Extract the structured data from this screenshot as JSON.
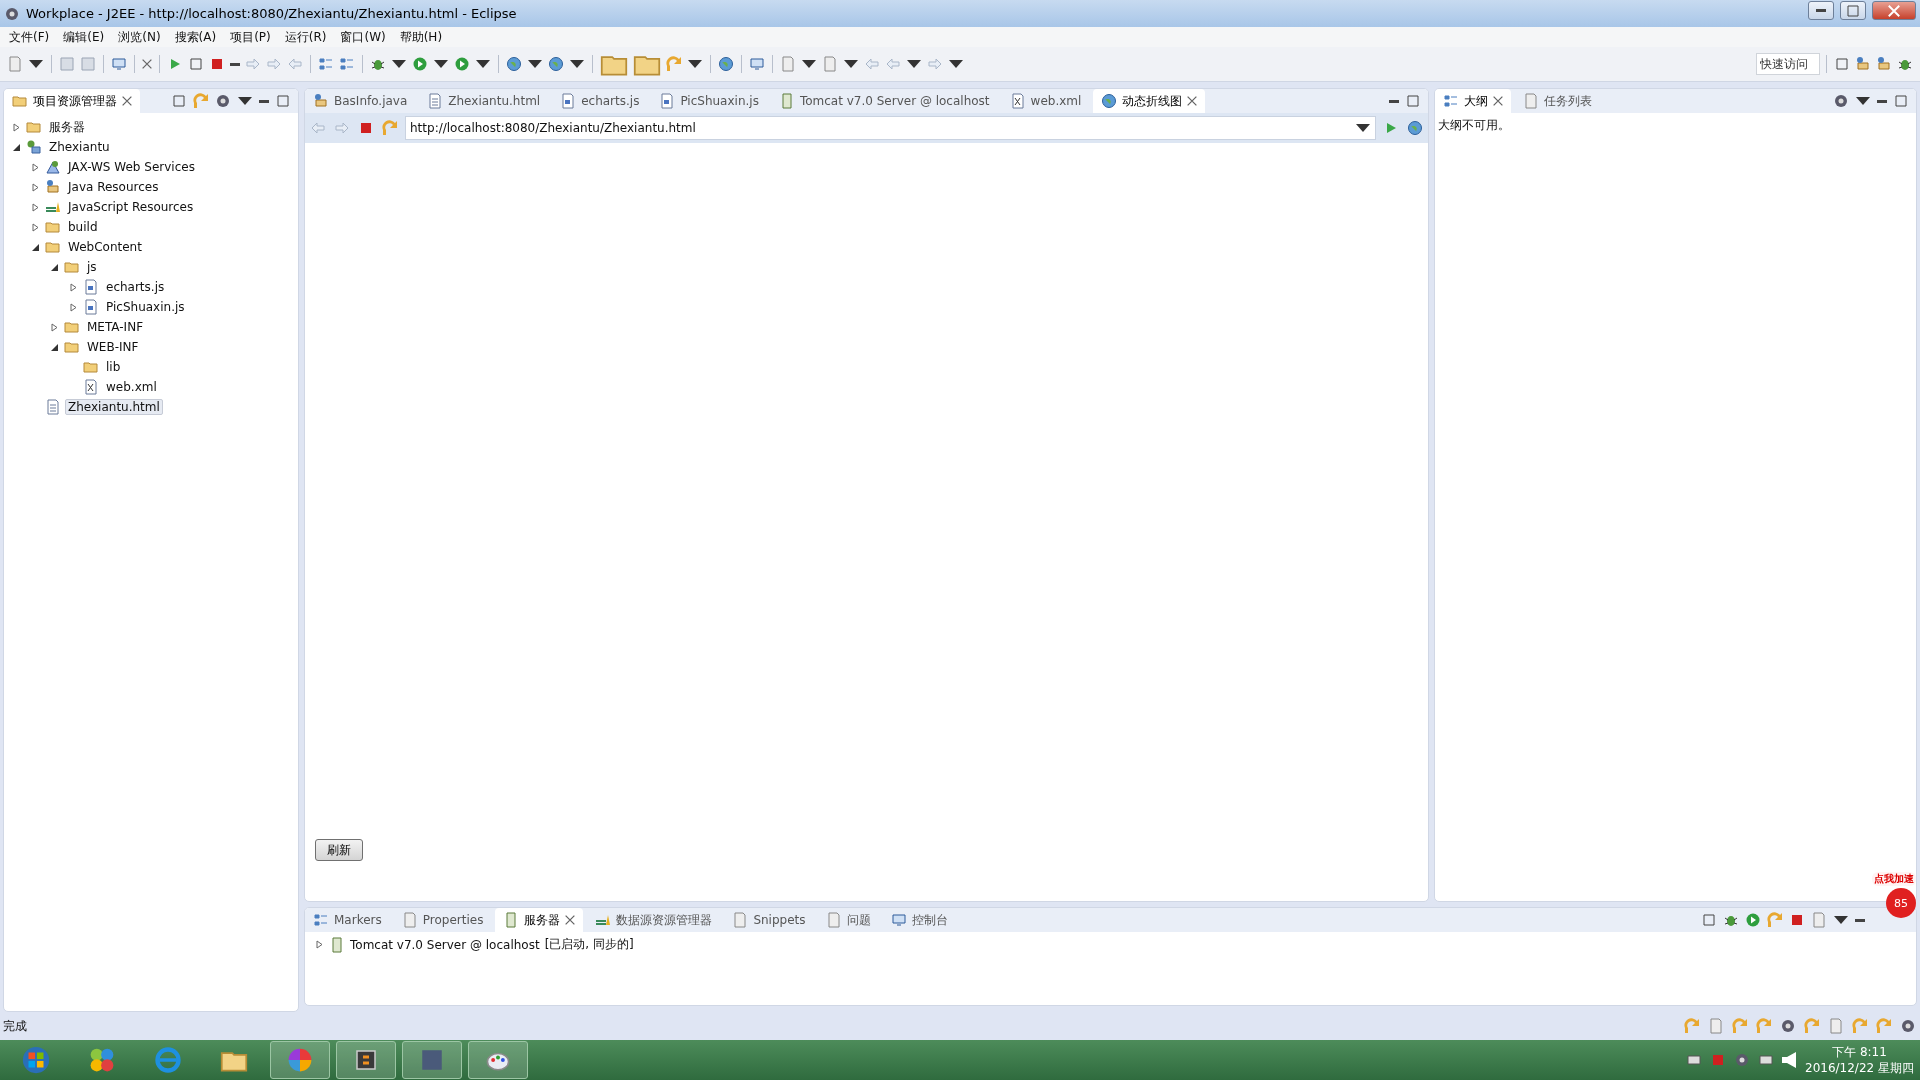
{
  "window": {
    "title": "Workplace - J2EE - http://localhost:8080/Zhexiantu/Zhexiantu.html - Eclipse"
  },
  "menu": [
    "文件(F)",
    "编辑(E)",
    "浏览(N)",
    "搜索(A)",
    "项目(P)",
    "运行(R)",
    "窗口(W)",
    "帮助(H)"
  ],
  "quick_access": {
    "placeholder": "快速访问"
  },
  "project_explorer": {
    "title": "项目资源管理器",
    "items": [
      {
        "label": "服务器",
        "kind": "folder",
        "expanded": false,
        "selected": false
      },
      {
        "label": "Zhexiantu",
        "kind": "project",
        "expanded": true,
        "selected": false,
        "children": [
          {
            "label": "JAX-WS Web Services",
            "kind": "service",
            "expanded": false,
            "selected": false
          },
          {
            "label": "Java Resources",
            "kind": "java",
            "expanded": false,
            "selected": false
          },
          {
            "label": "JavaScript Resources",
            "kind": "books",
            "expanded": false,
            "selected": false
          },
          {
            "label": "build",
            "kind": "folder",
            "expanded": false,
            "selected": false
          },
          {
            "label": "WebContent",
            "kind": "folder",
            "expanded": true,
            "selected": false,
            "children": [
              {
                "label": "js",
                "kind": "folder",
                "expanded": true,
                "selected": false,
                "children": [
                  {
                    "label": "echarts.js",
                    "kind": "script",
                    "expanded": false,
                    "selected": false
                  },
                  {
                    "label": "PicShuaxin.js",
                    "kind": "script",
                    "expanded": false,
                    "selected": false
                  }
                ]
              },
              {
                "label": "META-INF",
                "kind": "folder",
                "expanded": false,
                "selected": false
              },
              {
                "label": "WEB-INF",
                "kind": "folder",
                "expanded": true,
                "selected": false,
                "children": [
                  {
                    "label": "lib",
                    "kind": "folder",
                    "selected": false
                  },
                  {
                    "label": "web.xml",
                    "kind": "xml",
                    "selected": false
                  }
                ]
              }
            ]
          },
          {
            "label": "Zhexiantu.html",
            "kind": "html",
            "selected": true
          }
        ]
      }
    ]
  },
  "editor_tabs": [
    {
      "label": "BasInfo.java",
      "kind": "java",
      "selected": false
    },
    {
      "label": "Zhexiantu.html",
      "kind": "html",
      "selected": false
    },
    {
      "label": "echarts.js",
      "kind": "script",
      "selected": false
    },
    {
      "label": "PicShuaxin.js",
      "kind": "script",
      "selected": false
    },
    {
      "label": "Tomcat v7.0 Server @ localhost",
      "kind": "server",
      "selected": false
    },
    {
      "label": "web.xml",
      "kind": "xml",
      "selected": false
    },
    {
      "label": "动态折线图",
      "kind": "globe",
      "selected": true
    }
  ],
  "browser": {
    "url": "http://localhost:8080/Zhexiantu/Zhexiantu.html",
    "button": "刷新"
  },
  "outline_tabs": [
    {
      "label": "大纲",
      "selected": true
    },
    {
      "label": "任务列表",
      "selected": false
    }
  ],
  "outline_message": "大纲不可用。",
  "bottom_tabs": [
    {
      "label": "Markers",
      "selected": false
    },
    {
      "label": "Properties",
      "selected": false
    },
    {
      "label": "服务器",
      "selected": true
    },
    {
      "label": "数据源资源管理器",
      "selected": false
    },
    {
      "label": "Snippets",
      "selected": false
    },
    {
      "label": "问题",
      "selected": false
    },
    {
      "label": "控制台",
      "selected": false
    }
  ],
  "servers": [
    {
      "name": "Tomcat v7.0 Server @ localhost",
      "state": "[已启动, 同步的]",
      "expanded": false
    }
  ],
  "status_bar": {
    "message": "完成"
  },
  "speed_widget": {
    "label": "点我加速",
    "count": "85"
  },
  "taskbar": {
    "time": "下午 8:11",
    "date": "2016/12/22 星期四"
  }
}
